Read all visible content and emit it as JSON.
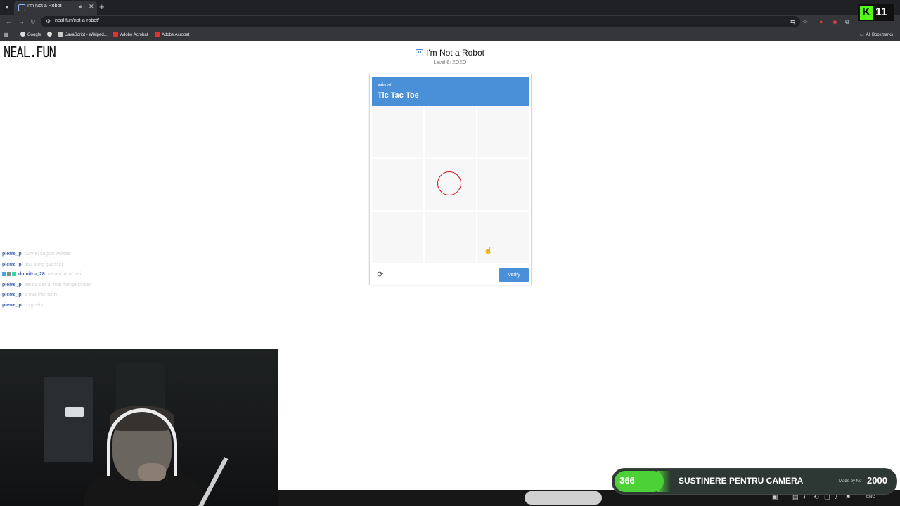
{
  "browser": {
    "tab_title": "I'm Not a Robot",
    "new_tab": "+",
    "url": "neal.fun/not-a-robot/",
    "bookmarks": [
      "Google",
      "JavaScript - Wikiped...",
      "Adobe Acrobat",
      "Adobe Acrobat"
    ],
    "all_bookmarks": "All Bookmarks"
  },
  "overlay_badge": {
    "letter": "K",
    "count": "11"
  },
  "page": {
    "logo": "NEAL.FUN",
    "title": "I'm Not a Robot",
    "level": "Level 6: XOXO"
  },
  "captcha": {
    "header_small": "Win at",
    "header_title": "Tic Tac Toe",
    "board": [
      "",
      "",
      "",
      "",
      "O",
      "",
      "",
      "",
      ""
    ],
    "verify_label": "Verify",
    "reload_icon": "refresh-icon"
  },
  "chat": [
    {
      "user": "pierre_p",
      "message": ": cu vrei sa joci wordle",
      "badges": false
    },
    {
      "user": "pierre_p",
      "message": ": sau song guesser",
      "badges": false
    },
    {
      "user": "dumitru_28",
      "message": ": ce-am jucat ieri",
      "badges": true
    },
    {
      "user": "pierre_p",
      "message": ": pai da dar ar mai merge sincer",
      "badges": false
    },
    {
      "user": "pierre_p",
      "message": ": a mai interactiv",
      "badges": false
    },
    {
      "user": "pierre_p",
      "message": ": cu ghetto",
      "badges": false
    }
  ],
  "goal": {
    "current": "366",
    "label": "SUSTINERE PENTRU CAMERA",
    "made_by": "Made by Ne",
    "target": "2000",
    "progress": 0.183
  },
  "taskbar": {
    "lang": "ENG"
  },
  "colors": {
    "header_blue": "#4a90d9",
    "o_mark": "#cc1020",
    "goal_green": "#4cd137",
    "kick_green": "#53fc18"
  }
}
